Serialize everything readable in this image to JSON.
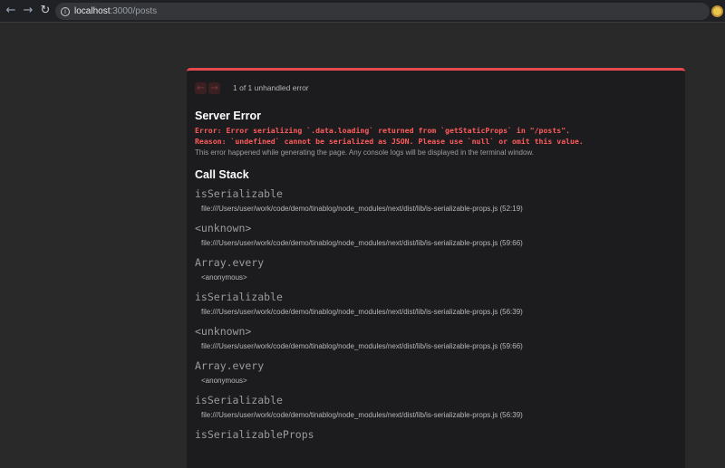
{
  "browser": {
    "back_icon": "arrow-left-icon",
    "forward_icon": "arrow-right-icon",
    "reload_icon": "reload-icon",
    "url_host": "localhost",
    "url_path": ":3000/posts"
  },
  "error_overlay": {
    "pager_text": "1 of 1 unhandled error",
    "title": "Server Error",
    "message_line1": "Error: Error serializing `.data.loading` returned from `getStaticProps` in \"/posts\".",
    "message_line2": "Reason: `undefined` cannot be serialized as JSON. Please use `null` or omit this value.",
    "note": "This error happened while generating the page. Any console logs will be displayed in the terminal window.",
    "call_stack_title": "Call Stack",
    "frames": [
      {
        "fn": "isSerializable",
        "loc": "file:///Users/user/work/code/demo/tinablog/node_modules/next/dist/lib/is-serializable-props.js (52:19)"
      },
      {
        "fn": "<unknown>",
        "loc": "file:///Users/user/work/code/demo/tinablog/node_modules/next/dist/lib/is-serializable-props.js (59:66)"
      },
      {
        "fn": "Array.every",
        "loc": "<anonymous>"
      },
      {
        "fn": "isSerializable",
        "loc": "file:///Users/user/work/code/demo/tinablog/node_modules/next/dist/lib/is-serializable-props.js (56:39)"
      },
      {
        "fn": "<unknown>",
        "loc": "file:///Users/user/work/code/demo/tinablog/node_modules/next/dist/lib/is-serializable-props.js (59:66)"
      },
      {
        "fn": "Array.every",
        "loc": "<anonymous>"
      },
      {
        "fn": "isSerializable",
        "loc": "file:///Users/user/work/code/demo/tinablog/node_modules/next/dist/lib/is-serializable-props.js (56:39)"
      },
      {
        "fn": "isSerializableProps",
        "loc": ""
      }
    ]
  },
  "colors": {
    "accent_red": "#e5484d",
    "error_text": "#ff5b5b",
    "overlay_bg": "#1c1c1e",
    "page_bg": "#292929"
  }
}
